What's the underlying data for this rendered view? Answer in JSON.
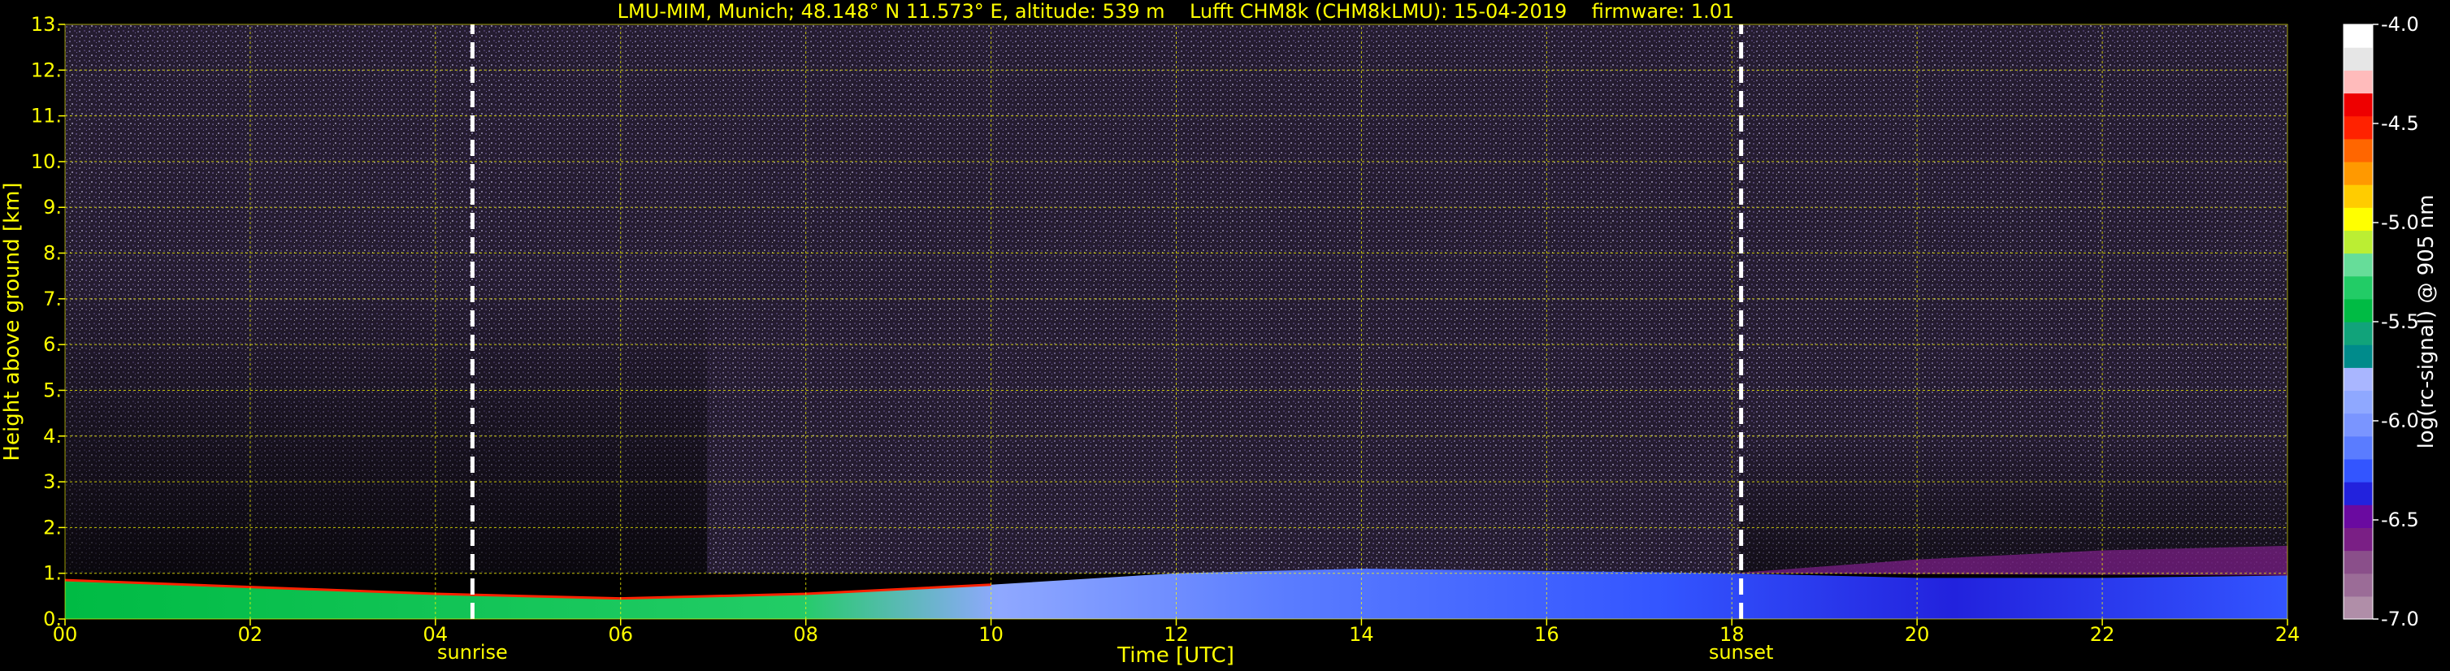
{
  "chart_data": {
    "type": "heatmap",
    "title": "LMU-MIM, Munich; 48.148° N 11.573° E, altitude: 539 m    Lufft CHM8k (CHM8kLMU): 15-04-2019    firmware: 1.01",
    "xlabel": "Time [UTC]",
    "ylabel": "Height above ground [km]",
    "xlim": [
      0,
      24
    ],
    "ylim": [
      0,
      13
    ],
    "x_ticks": [
      "00",
      "02",
      "04",
      "06",
      "08",
      "10",
      "12",
      "14",
      "16",
      "18",
      "20",
      "22",
      "24"
    ],
    "y_ticks": [
      "0.",
      "1.",
      "2.",
      "3.",
      "4.",
      "5.",
      "6.",
      "7.",
      "8.",
      "9.",
      "10.",
      "11.",
      "12.",
      "13."
    ],
    "grid": true,
    "grid_color": "#ffff00",
    "annotations": [
      {
        "label": "sunrise",
        "x": 4.4
      },
      {
        "label": "sunset",
        "x": 18.1
      }
    ],
    "colorbar": {
      "label": "log(rc-signal) @ 905 nm",
      "ticks": [
        "-4.0",
        "-4.5",
        "-5.0",
        "-5.5",
        "-6.0",
        "-6.5",
        "-7.0"
      ],
      "range": [
        -7.0,
        -4.0
      ],
      "colors": [
        "#b08ea8",
        "#9b6c97",
        "#8a4f8a",
        "#7a1f85",
        "#6a0aa0",
        "#2222dd",
        "#3355ff",
        "#5a7cff",
        "#7a95ff",
        "#8fa8ff",
        "#a9b6ff",
        "#008b8b",
        "#11a37a",
        "#00bb44",
        "#22cc66",
        "#66dd99",
        "#bbee33",
        "#ffff00",
        "#ffcc00",
        "#ff9900",
        "#ff6600",
        "#ff2200",
        "#ee0000",
        "#ffbbbb",
        "#e6e6e6",
        "#ffffff"
      ]
    },
    "layers": [
      {
        "name": "noise",
        "height_range": [
          1.0,
          13.0
        ],
        "value": -6.6
      },
      {
        "name": "boundary layer",
        "x": [
          0,
          2,
          4,
          6,
          8,
          10,
          12,
          14,
          16,
          18,
          20,
          22,
          24
        ],
        "top": [
          0.85,
          0.7,
          0.55,
          0.45,
          0.55,
          0.75,
          1.0,
          1.1,
          1.05,
          1.0,
          0.9,
          0.9,
          0.95
        ],
        "value": -6.0
      }
    ]
  }
}
